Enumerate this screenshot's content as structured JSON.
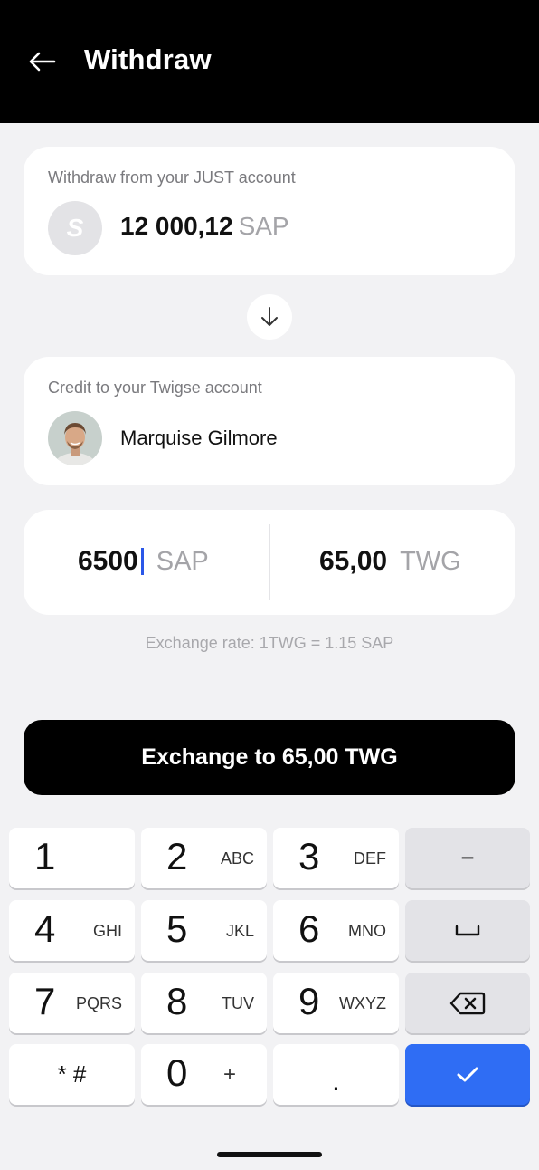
{
  "header": {
    "title": "Withdraw",
    "back_icon": "arrow-left-icon"
  },
  "from_card": {
    "label": "Withdraw from your JUST account",
    "coin_letter": "S",
    "balance": "12 000,12",
    "currency": "SAP"
  },
  "to_card": {
    "label": "Credit to your Twigse account",
    "recipient_name": "Marquise Gilmore"
  },
  "amount": {
    "send_value": "6500",
    "send_currency": "SAP",
    "receive_value": "65,00",
    "receive_currency": "TWG"
  },
  "exchange_rate": "Exchange rate: 1TWG = 1.15 SAP",
  "exchange_button": "Exchange to 65,00 TWG",
  "keypad": {
    "k1": {
      "digit": "1",
      "letters": ""
    },
    "k2": {
      "digit": "2",
      "letters": "ABC"
    },
    "k3": {
      "digit": "3",
      "letters": "DEF"
    },
    "k4": {
      "digit": "4",
      "letters": "GHI"
    },
    "k5": {
      "digit": "5",
      "letters": "JKL"
    },
    "k6": {
      "digit": "6",
      "letters": "MNO"
    },
    "k7": {
      "digit": "7",
      "letters": "PQRS"
    },
    "k8": {
      "digit": "8",
      "letters": "TUV"
    },
    "k9": {
      "digit": "9",
      "letters": "WXYZ"
    },
    "k0": {
      "digit": "0",
      "letters": "+"
    },
    "star_hash": "* #",
    "dot": ".",
    "minus": "−"
  },
  "colors": {
    "accent": "#2f6df4",
    "header_bg": "#000000",
    "page_bg": "#f2f2f4"
  }
}
